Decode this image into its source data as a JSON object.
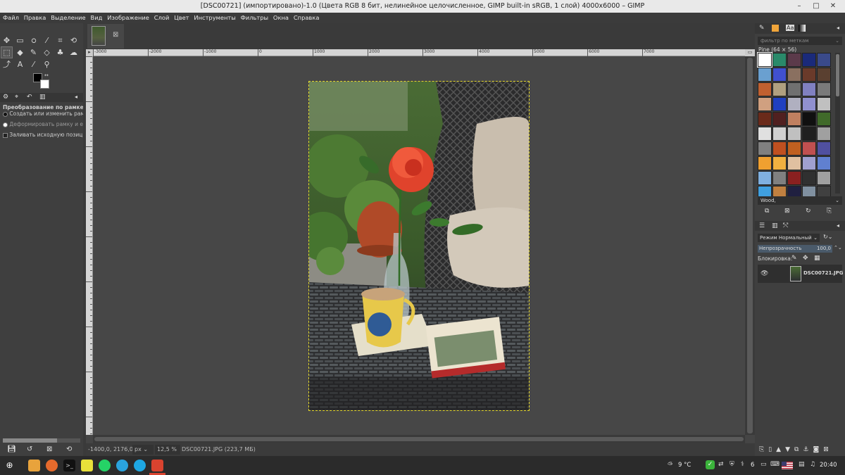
{
  "window": {
    "title": "[DSC00721] (импортировано)-1.0 (Цвета RGB 8 бит, нелинейное целочисленное, GIMP built-in sRGB, 1 слой) 4000x6000 – GIMP"
  },
  "menu": [
    "Файл",
    "Правка",
    "Выделение",
    "Вид",
    "Изображение",
    "Слой",
    "Цвет",
    "Инструменты",
    "Фильтры",
    "Окна",
    "Справка"
  ],
  "tool_options": {
    "title": "Преобразование по рамке",
    "opt1": "Создать или изменить рамку",
    "opt2": "Деформировать рамку и её",
    "opt3": "Заливать исходную позицию"
  },
  "hruler_ticks": [
    "-3000",
    "-2000",
    "-1000",
    "0",
    "1000",
    "2000",
    "3000",
    "4000",
    "5000",
    "6000",
    "7000"
  ],
  "status": {
    "coords": "-1400,0, 2176,0",
    "unit": "px",
    "zoom": "12,5 %",
    "file": "DSC00721.JPG (223,7 МБ)"
  },
  "patterns": {
    "filter_placeholder": "фильтр по меткам",
    "selected_name": "Pine (64 × 56)",
    "current": "Wood,"
  },
  "layers": {
    "mode_label": "Режим Нормальный",
    "opacity_label": "Непрозрачность",
    "opacity_value": "100,0",
    "lock_label": "Блокировка:",
    "layer_name": "DSC00721.JPG"
  },
  "taskbar": {
    "temp": "9 °C",
    "count": "6",
    "time": "20:40"
  },
  "colors": {
    "accent": "#e5d82b",
    "fg": "#000000",
    "bg": "#ffffff"
  }
}
